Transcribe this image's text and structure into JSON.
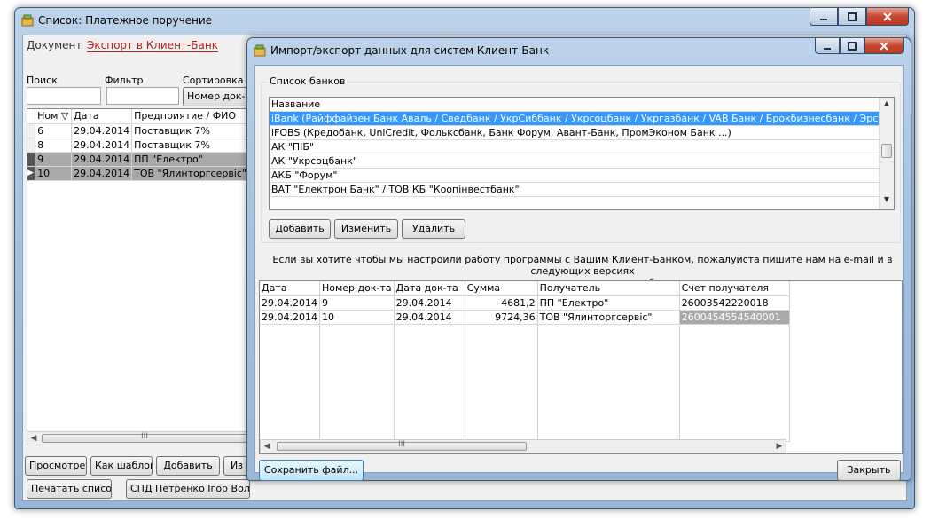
{
  "back_window": {
    "title": "Список: Платежное поручение",
    "menu": [
      "Документ",
      "Экспорт в Клиент-Банк"
    ],
    "labels": {
      "search": "Поиск",
      "filter": "Фильтр",
      "sort": "Сортировка (г"
    },
    "sort_button": "Номер док-т",
    "table": {
      "columns": [
        "Ном ▽",
        "Дата",
        "Предприятие / ФИО"
      ],
      "rows": [
        [
          "6",
          "29.04.2014",
          "Поставщик 7%"
        ],
        [
          "8",
          "29.04.2014",
          "Поставщик 7%"
        ],
        [
          "9",
          "29.04.2014",
          "ПП \"Електро\""
        ],
        [
          "10",
          "29.04.2014",
          "ТОВ \"Ялинторгсервіс\""
        ]
      ]
    },
    "scroll_grip": "III",
    "buttons_row1": [
      "Просмотреть",
      "Как шаблон",
      "Добавить",
      "Из"
    ],
    "buttons_row2": [
      "Печатать список",
      "СПД Петренко Ігор Воло"
    ]
  },
  "dialog": {
    "title": "Импорт/экспорт данных для систем Клиент-Банк",
    "bank_list": {
      "group_title": "Список банков",
      "header": "Название",
      "items": [
        "iBank (Райффайзен Банк Аваль / Сведбанк / УкрСиббанк / Укрсоцбанк / Укргазбанк / VAB Банк / Брокбизнесбанк / Эрсте Банк ...",
        "iFOBS (Кредобанк, UniCredit, Фолькcбанк, Банк Форум, Авант-Банк, ПромЭконом Банк ...)",
        "АК \"ПІБ\"",
        "АК \"Укрсоцбанк\"",
        "АКБ \"Форум\"",
        "ВАТ \"Електрон Банк\" / ТОВ КБ \"Коопінвестбанк\""
      ],
      "buttons": [
        "Добавить",
        "Изменить",
        "Удалить"
      ]
    },
    "info_line1": "Если вы хотите чтобы мы настроили работу программы с Вашим Клиент-Банком, пожалуйста пишите нам на e-mail и в следующих версиях",
    "info_line2": "появится поддержка и вашего банка",
    "export_table": {
      "columns": [
        "Дата",
        "Номер док-та",
        "Дата док-та",
        "Сумма",
        "Получатель",
        "Счет получателя"
      ],
      "rows": [
        [
          "29.04.2014",
          "9",
          "29.04.2014",
          "4681,2",
          "ПП \"Електро\"",
          "26003542220018"
        ],
        [
          "29.04.2014",
          "10",
          "29.04.2014",
          "9724,36",
          "ТОВ \"Ялинторгсервіс\"",
          "2600454554540001"
        ]
      ]
    },
    "scroll_grip": "III",
    "save_button": "Сохранить файл...",
    "close_button": "Закрыть"
  },
  "colors": {
    "selection": "#3399ff",
    "close_red": "#c7462f",
    "accent_link": "#b51f1f"
  }
}
